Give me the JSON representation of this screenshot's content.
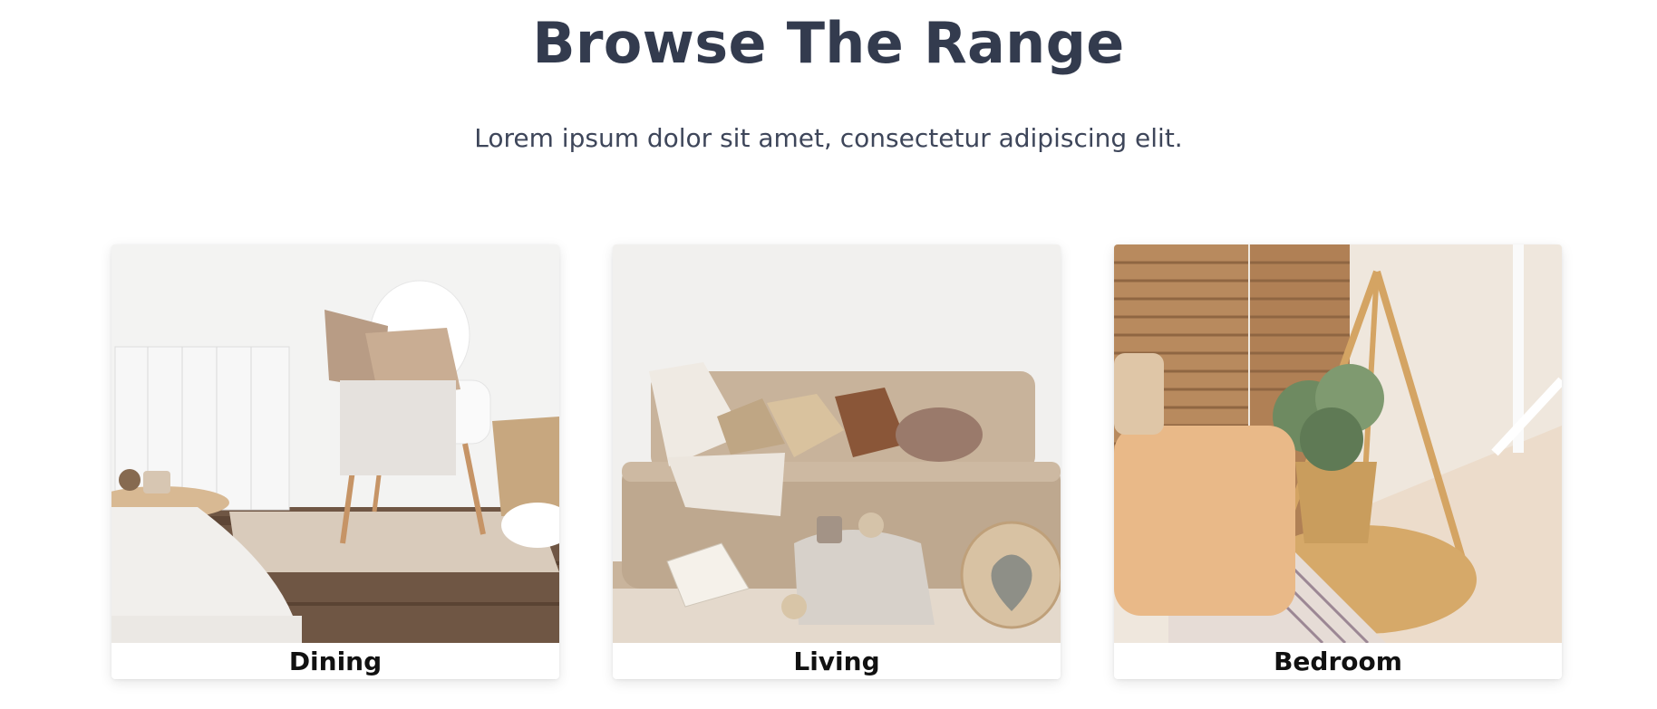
{
  "section": {
    "title": "Browse The Range",
    "subtitle": "Lorem ipsum dolor sit amet, consectetur adipiscing elit."
  },
  "categories": [
    {
      "label": "Dining",
      "image": "dining-room-photo"
    },
    {
      "label": "Living",
      "image": "living-room-photo"
    },
    {
      "label": "Bedroom",
      "image": "bedroom-photo"
    }
  ],
  "colors": {
    "heading": "#333b4e",
    "subtitle": "#3e465a",
    "label": "#111111",
    "card_background": "#ffffff"
  }
}
